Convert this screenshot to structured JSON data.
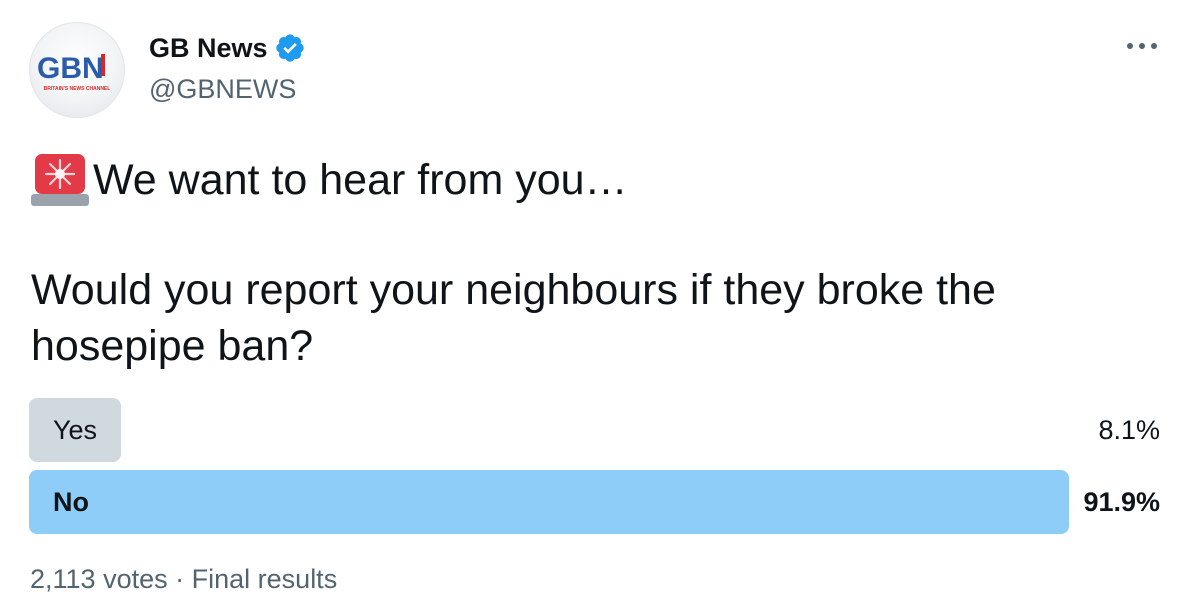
{
  "author": {
    "display_name": "GB News",
    "handle": "@GBNEWS",
    "avatar_text": "GBN",
    "avatar_tagline": "BRITAIN'S NEWS CHANNEL",
    "verified_icon": "verified-badge-icon"
  },
  "tweet": {
    "line1": "We want to hear from you…",
    "line1_icon": "siren-icon",
    "question": "Would you report your neighbours if they broke the hosepipe ban?"
  },
  "poll": {
    "options": [
      {
        "label": "Yes",
        "percent_text": "8.1%",
        "percent": 8.1
      },
      {
        "label": "No",
        "percent_text": "91.9%",
        "percent": 91.9
      }
    ],
    "footer": {
      "votes": "2,113 votes",
      "separator": "·",
      "status": "Final results"
    }
  },
  "colors": {
    "accent": "#1d9bf0",
    "winning_bar": "#8ecdf8",
    "losing_bar": "#cfd9de",
    "secondary_text": "#536471"
  }
}
